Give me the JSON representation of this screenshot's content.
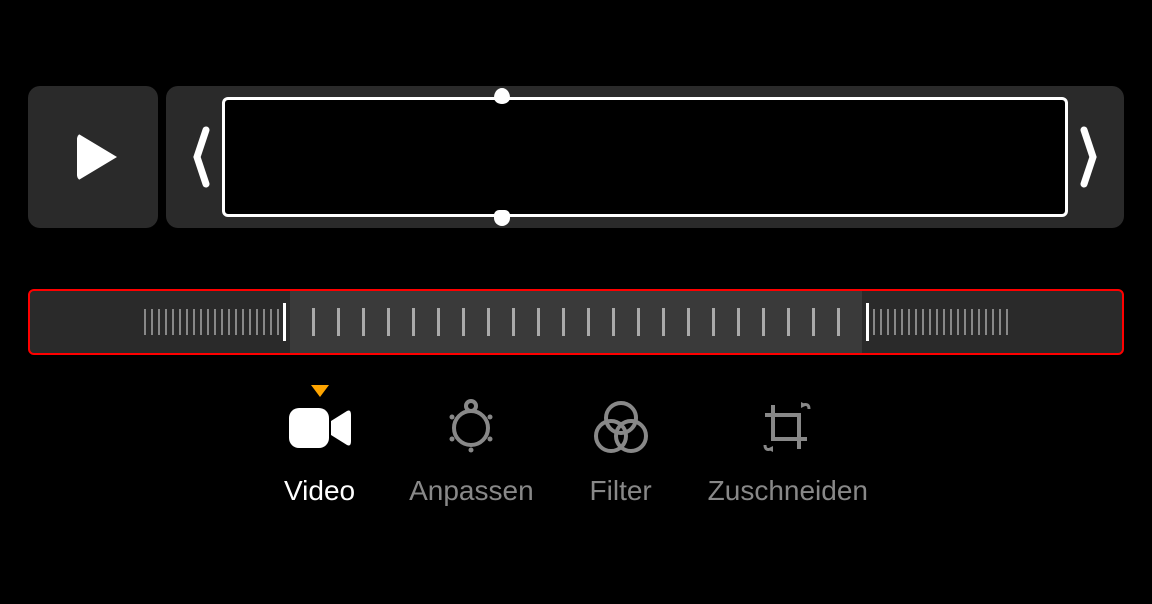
{
  "tabs": {
    "video": {
      "label": "Video",
      "active": true
    },
    "adjust": {
      "label": "Anpassen",
      "active": false
    },
    "filter": {
      "label": "Filter",
      "active": false
    },
    "crop": {
      "label": "Zuschneiden",
      "active": false
    }
  },
  "scrubber": {
    "highlighted": true
  }
}
